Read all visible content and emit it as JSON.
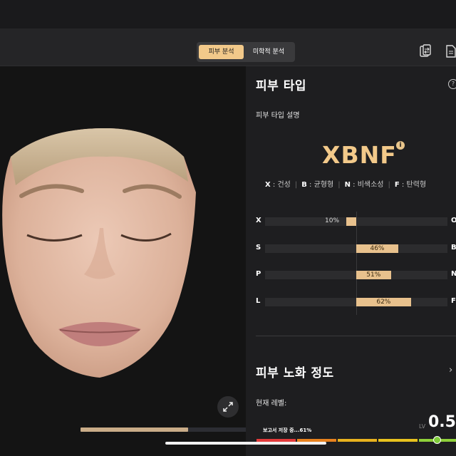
{
  "header": {
    "tabs": [
      {
        "label": "피부 분석",
        "active": true
      },
      {
        "label": "미학적 분석",
        "active": false
      }
    ],
    "icons": [
      "compare-icon",
      "report-icon"
    ]
  },
  "viewer": {
    "expand_icon": "expand-icon",
    "progress_fraction": 0.61
  },
  "skin_type": {
    "title": "피부 타입",
    "help_glyph": "?",
    "description_label": "피부 타입 설명",
    "code": "XBNF",
    "info_glyph": "i",
    "legend": [
      {
        "key": "X",
        "text": "건성"
      },
      {
        "key": "B",
        "text": "균형형"
      },
      {
        "key": "N",
        "text": "비색소성"
      },
      {
        "key": "F",
        "text": "탄력형"
      }
    ],
    "bars": [
      {
        "left": "X",
        "right": "O",
        "value": 10,
        "label": "10%"
      },
      {
        "left": "S",
        "right": "B",
        "value": 46,
        "label": "46%"
      },
      {
        "left": "P",
        "right": "N",
        "value": 51,
        "label": "51%"
      },
      {
        "left": "L",
        "right": "F",
        "value": 62,
        "label": "62%"
      }
    ]
  },
  "aging": {
    "title": "피부 노화 정도",
    "chevron": "›",
    "current_level_label": "현재 레벨:",
    "lv_prefix": "LV",
    "level_value": "0.5",
    "saving_status": "보고서 저장 중...61%",
    "level_colors": [
      "#e23b3b",
      "#e8821e",
      "#e8b21e",
      "#e8c21e",
      "#8fd13a"
    ]
  }
}
